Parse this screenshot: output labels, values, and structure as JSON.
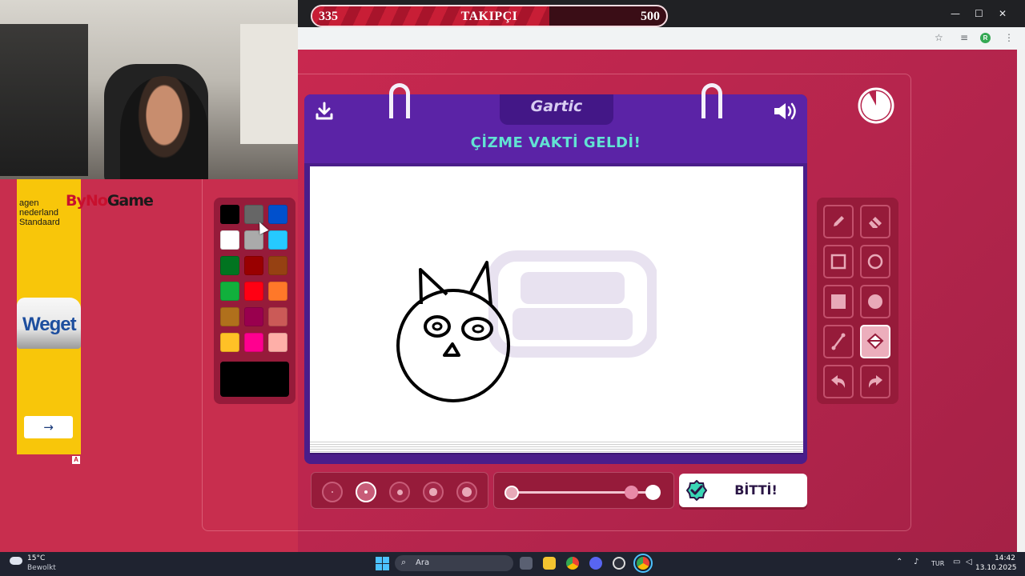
{
  "overlay": {
    "goal_current": "335",
    "goal_label": "TAKIPÇI",
    "goal_target": "500",
    "goal_progress": 0.67
  },
  "ad": {
    "logo_prefix": "ByNo",
    "logo_suffix": "Game",
    "line1": "agen",
    "line2": "nederland",
    "line3": "Standaard",
    "car_text": "Weget",
    "button_arrow": "→",
    "choice_mark": "A"
  },
  "game": {
    "logo": "Gartic",
    "title": "ÇİZME VAKTİ GELDİ!",
    "download_icon": "download-icon",
    "sound_icon": "speaker-icon",
    "timer_remaining_fraction": 0.92,
    "done_label": "BİTTİ!",
    "palette": [
      "#000000",
      "#666666",
      "#0050cd",
      "#ffffff",
      "#aaaaaa",
      "#26c9ff",
      "#017420",
      "#990000",
      "#964112",
      "#11b03c",
      "#ff0013",
      "#ff7829",
      "#b0701c",
      "#99004e",
      "#cb5a57",
      "#ffc126",
      "#ff008f",
      "#feafa8"
    ],
    "current_color": "#000000",
    "brush_sizes": 5,
    "active_brush_size": 2,
    "active_tool": "fill-bucket",
    "tools": [
      "pencil",
      "eraser",
      "rectangle-outline",
      "ellipse-outline",
      "rectangle-filled",
      "ellipse-filled",
      "line",
      "fill-bucket",
      "undo",
      "redo"
    ]
  },
  "taskbar": {
    "weather_temp": "15°C",
    "weather_desc": "Bewolkt",
    "search_placeholder": "Ara",
    "language": "TUR",
    "time": "14:42",
    "date": "13.10.2025"
  }
}
